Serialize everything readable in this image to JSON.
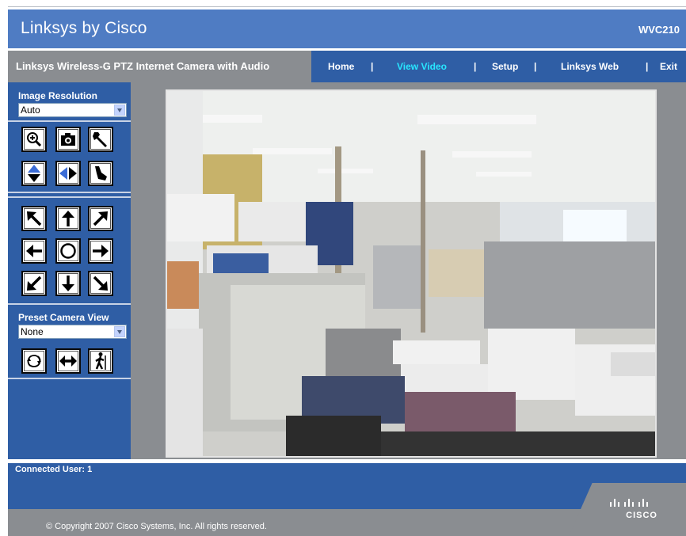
{
  "header": {
    "brand": "Linksys by Cisco",
    "model": "WVC210"
  },
  "nav": {
    "product_title": "Linksys Wireless-G PTZ Internet Camera with Audio",
    "items": [
      {
        "label": "Home",
        "active": false
      },
      {
        "label": "View Video",
        "active": true
      },
      {
        "label": "Setup",
        "active": false
      },
      {
        "label": "Linksys Web",
        "active": false
      },
      {
        "label": "Exit",
        "active": false
      }
    ],
    "separator": "|"
  },
  "sidebar": {
    "resolution_label": "Image Resolution",
    "resolution_value": "Auto",
    "preset_label": "Preset Camera View",
    "preset_value": "None",
    "tool_icons": [
      "zoom-in-icon",
      "snapshot-camera-icon",
      "wrench-icon",
      "vertical-flip-icon",
      "horizontal-flip-icon",
      "brush-icon"
    ],
    "direction_icons": [
      "arrow-up-left-icon",
      "arrow-up-icon",
      "arrow-up-right-icon",
      "arrow-left-icon",
      "home-center-icon",
      "arrow-right-icon",
      "arrow-down-left-icon",
      "arrow-down-icon",
      "arrow-down-right-icon"
    ],
    "patrol_icons": [
      "patrol-icon",
      "pan-auto-icon",
      "walking-person-icon"
    ]
  },
  "footer": {
    "connected": "Connected User: 1",
    "copyright": "© Copyright 2007 Cisco Systems, Inc. All rights reserved.",
    "logo_text": "CISCO"
  },
  "colors": {
    "brand_blue": "#4f7cc3",
    "nav_blue": "#2f5ea5",
    "gray": "#8a8d91",
    "active_nav": "#28e6ff"
  }
}
